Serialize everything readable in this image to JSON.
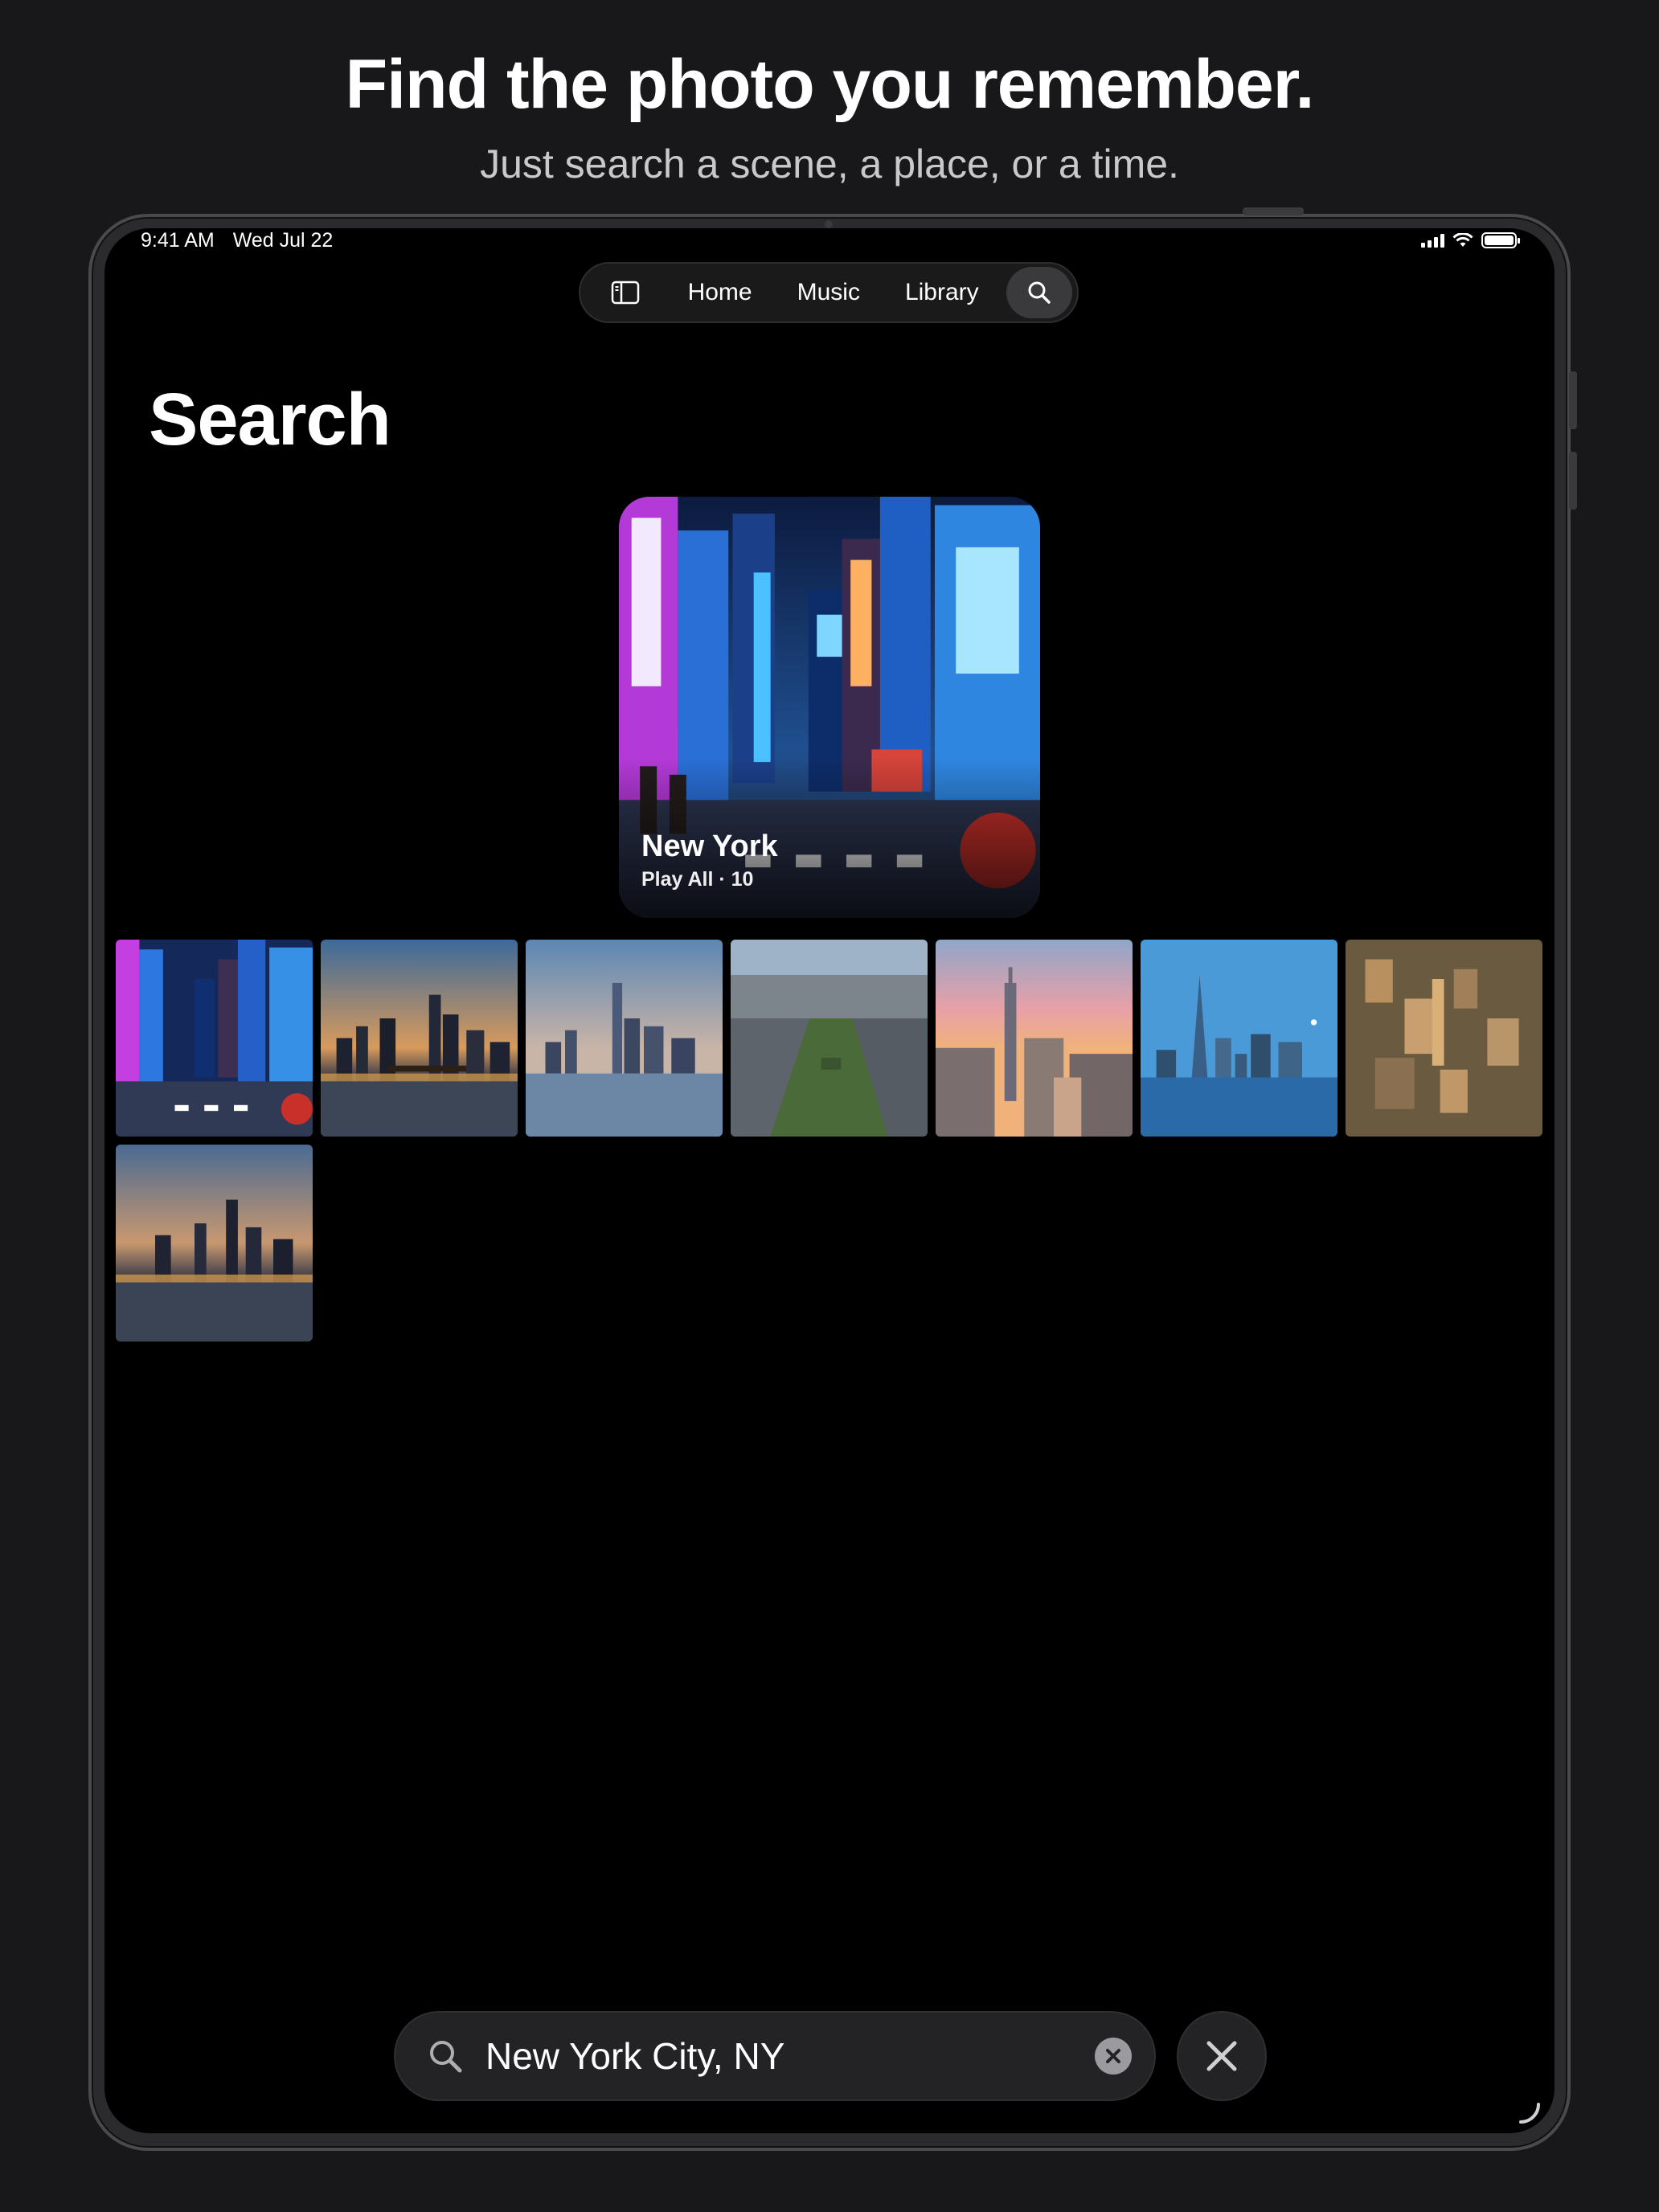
{
  "promo": {
    "title": "Find the photo you remember.",
    "subtitle": "Just search a scene, a place, or a time."
  },
  "status_bar": {
    "time": "9:41 AM",
    "date": "Wed Jul 22",
    "icons": [
      "cellular-signal-icon",
      "wifi-icon",
      "battery-icon"
    ]
  },
  "tab_bar": {
    "sidebar_icon": "sidebar-toggle-icon",
    "tabs": [
      {
        "label": "Home"
      },
      {
        "label": "Music"
      },
      {
        "label": "Library"
      }
    ],
    "search_icon": "search-icon",
    "selected": "search"
  },
  "page": {
    "title": "Search"
  },
  "featured": {
    "title": "New York",
    "meta": "Play All · 10",
    "image": "times-square-night"
  },
  "results": [
    {
      "image": "times-square-night"
    },
    {
      "image": "manhattan-skyline-dusk-bridge"
    },
    {
      "image": "lower-manhattan-skyline-water"
    },
    {
      "image": "central-park-aerial"
    },
    {
      "image": "midtown-sunset-empire-state"
    },
    {
      "image": "one-world-trade-blue-sky"
    },
    {
      "image": "manhattan-aerial-golden"
    },
    {
      "image": "brooklyn-bridge-skyline-dusk"
    }
  ],
  "search": {
    "value": "New York City, NY",
    "icon": "magnifier-icon",
    "clear_icon": "clear-circle-icon",
    "close_icon": "close-icon"
  },
  "colors": {
    "background": "#18181a",
    "screen": "#000000",
    "control": "#232325",
    "selected_tab": "#3a3a3c"
  }
}
